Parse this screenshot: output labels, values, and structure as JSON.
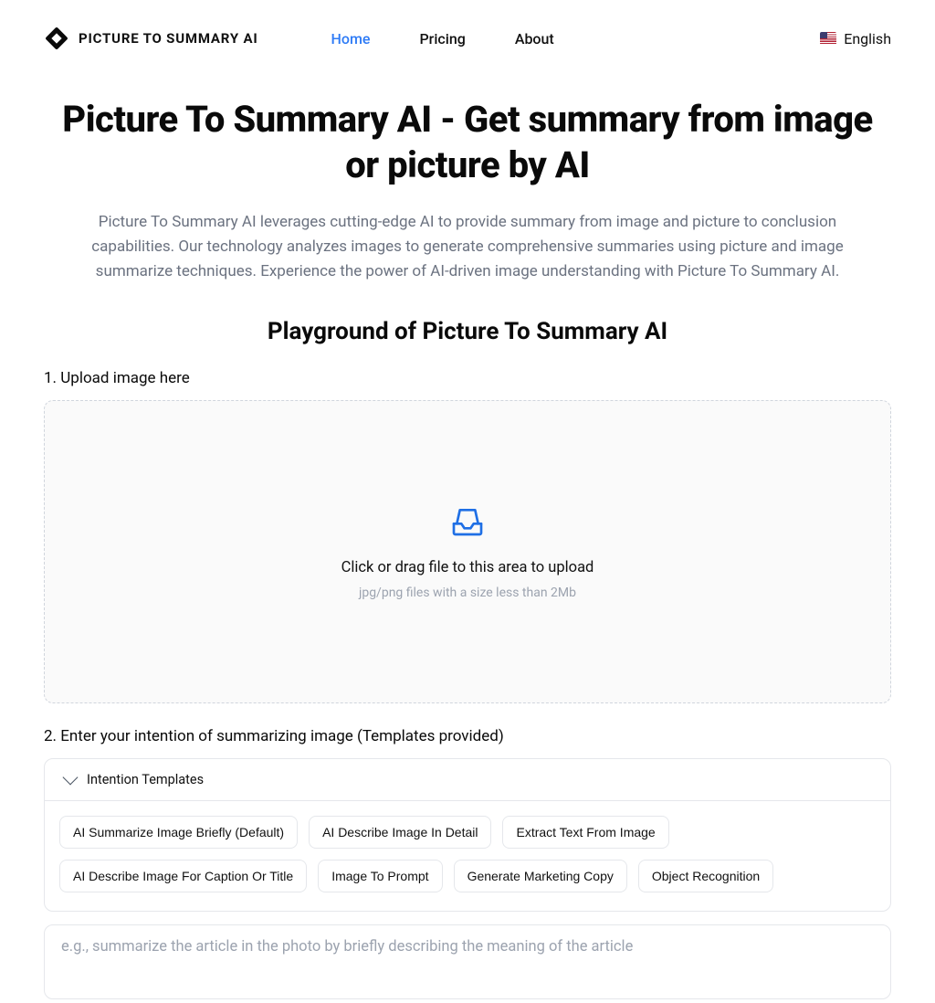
{
  "header": {
    "logo_text": "PICTURE TO SUMMARY AI",
    "nav": [
      {
        "label": "Home",
        "active": true
      },
      {
        "label": "Pricing",
        "active": false
      },
      {
        "label": "About",
        "active": false
      }
    ],
    "language": "English"
  },
  "hero": {
    "title": "Picture To Summary AI - Get summary from image or picture by AI",
    "subtitle": "Picture To Summary AI leverages cutting-edge AI to provide summary from image and picture to conclusion capabilities. Our technology analyzes images to generate comprehensive summaries using picture and image summarize techniques. Experience the power of AI-driven image understanding with Picture To Summary AI."
  },
  "playground": {
    "heading": "Playground of Picture To Summary AI",
    "step1_label": "1. Upload image here",
    "upload_main": "Click or drag file to this area to upload",
    "upload_sub": "jpg/png files with a size less than 2Mb",
    "step2_label": "2. Enter your intention of summarizing image (Templates provided)",
    "templates_header": "Intention Templates",
    "templates": [
      "AI Summarize Image Briefly (Default)",
      "AI Describe Image In Detail",
      "Extract Text From Image",
      "AI Describe Image For Caption Or Title",
      "Image To Prompt",
      "Generate Marketing Copy",
      "Object Recognition"
    ],
    "intent_placeholder": "e.g., summarize the article in the photo by briefly describing the meaning of the article"
  }
}
